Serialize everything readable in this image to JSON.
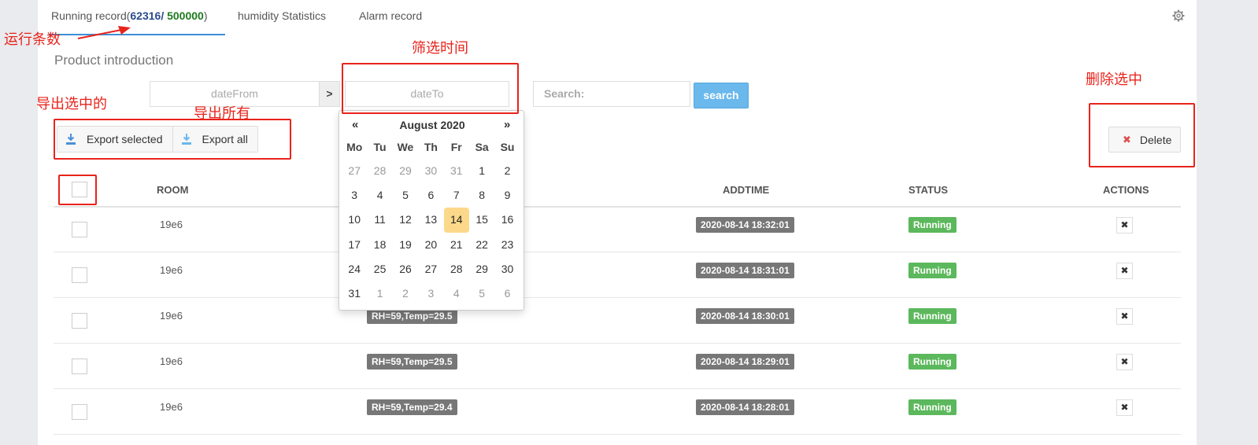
{
  "tabs": {
    "running_label": "Running record(",
    "running_count": "62316",
    "running_sep": "/ ",
    "running_total": "500000",
    "running_close": ")",
    "humidity": "humidity Statistics",
    "alarm": "Alarm record"
  },
  "section_title": "Product introduction",
  "filter": {
    "date_from_placeholder": "dateFrom",
    "date_to_placeholder": "dateTo",
    "search_placeholder": "Search:",
    "search_button": "search"
  },
  "toolbar": {
    "export_selected": "Export selected",
    "export_all": "Export all",
    "delete": "Delete"
  },
  "table": {
    "headers": {
      "room": "ROOM",
      "addtime": "ADDTIME",
      "status": "STATUS",
      "actions": "ACTIONS"
    },
    "rows": [
      {
        "room": "19e6",
        "value": "",
        "addtime": "2020-08-14 18:32:01",
        "status": "Running"
      },
      {
        "room": "19e6",
        "value": "",
        "addtime": "2020-08-14 18:31:01",
        "status": "Running"
      },
      {
        "room": "19e6",
        "value": "RH=59,Temp=29.5",
        "addtime": "2020-08-14 18:30:01",
        "status": "Running"
      },
      {
        "room": "19e6",
        "value": "RH=59,Temp=29.5",
        "addtime": "2020-08-14 18:29:01",
        "status": "Running"
      },
      {
        "room": "19e6",
        "value": "RH=59,Temp=29.4",
        "addtime": "2020-08-14 18:28:01",
        "status": "Running"
      }
    ]
  },
  "calendar": {
    "title": "August 2020",
    "prev": "«",
    "next": "»",
    "weekdays": [
      "Mo",
      "Tu",
      "We",
      "Th",
      "Fr",
      "Sa",
      "Su"
    ],
    "days": [
      "27",
      "28",
      "29",
      "30",
      "31",
      "1",
      "2",
      "3",
      "4",
      "5",
      "6",
      "7",
      "8",
      "9",
      "10",
      "11",
      "12",
      "13",
      "14",
      "15",
      "16",
      "17",
      "18",
      "19",
      "20",
      "21",
      "22",
      "23",
      "24",
      "25",
      "26",
      "27",
      "28",
      "29",
      "30",
      "31",
      "1",
      "2",
      "3",
      "4",
      "5",
      "6"
    ],
    "leading_old_count": 5,
    "trailing_old_count": 6,
    "selected": "14"
  },
  "annotations": {
    "row_count": "运行条数",
    "filter_time": "筛选时间",
    "export_selected": "导出选中的",
    "export_all": "导出所有",
    "delete_selected": "删除选中"
  },
  "colors": {
    "accent": "#3d8fd6",
    "annotation": "#e8231b",
    "running": "#5cb85c",
    "search": "#6ab8ec"
  }
}
